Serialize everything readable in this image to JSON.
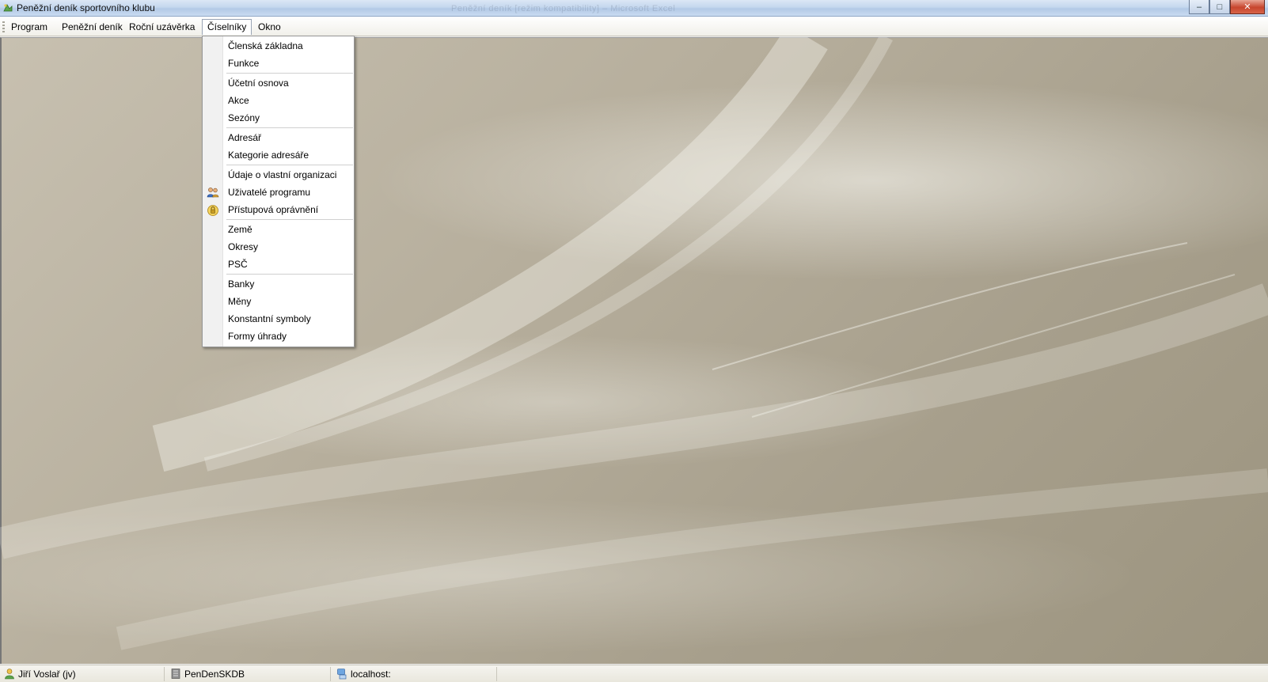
{
  "window": {
    "title": "Peněžní deník sportovního klubu",
    "ghost_title": "Peněžní deník [režim kompatibility] – Microsoft Excel",
    "controls": {
      "minimize_glyph": "–",
      "maximize_glyph": "□",
      "close_glyph": "✕"
    }
  },
  "menubar": {
    "items": [
      {
        "label": "Program"
      },
      {
        "label": "Peněžní deník"
      },
      {
        "label": "Roční uzávěrka"
      },
      {
        "label": "Číselníky",
        "active": true
      },
      {
        "label": "Okno"
      }
    ]
  },
  "dropdown": {
    "groups": [
      [
        {
          "label": "Členská základna"
        },
        {
          "label": "Funkce"
        }
      ],
      [
        {
          "label": "Účetní osnova"
        },
        {
          "label": "Akce"
        },
        {
          "label": "Sezóny"
        }
      ],
      [
        {
          "label": "Adresář"
        },
        {
          "label": "Kategorie adresáře"
        }
      ],
      [
        {
          "label": "Údaje o vlastní organizaci"
        },
        {
          "label": "Uživatelé programu",
          "icon": "users-icon"
        },
        {
          "label": "Přístupová oprávnění",
          "icon": "lock-icon"
        }
      ],
      [
        {
          "label": "Země"
        },
        {
          "label": "Okresy"
        },
        {
          "label": "PSČ"
        }
      ],
      [
        {
          "label": "Banky"
        },
        {
          "label": "Měny"
        },
        {
          "label": "Konstantní symboly"
        },
        {
          "label": "Formy úhrady"
        }
      ]
    ]
  },
  "statusbar": {
    "user": "Jiří Voslař  (jv)",
    "database": "PenDenSKDB",
    "server": "localhost:"
  },
  "colors": {
    "accent": "#c5d7ee",
    "background": "#b6ae9c",
    "close": "#c7452d"
  }
}
